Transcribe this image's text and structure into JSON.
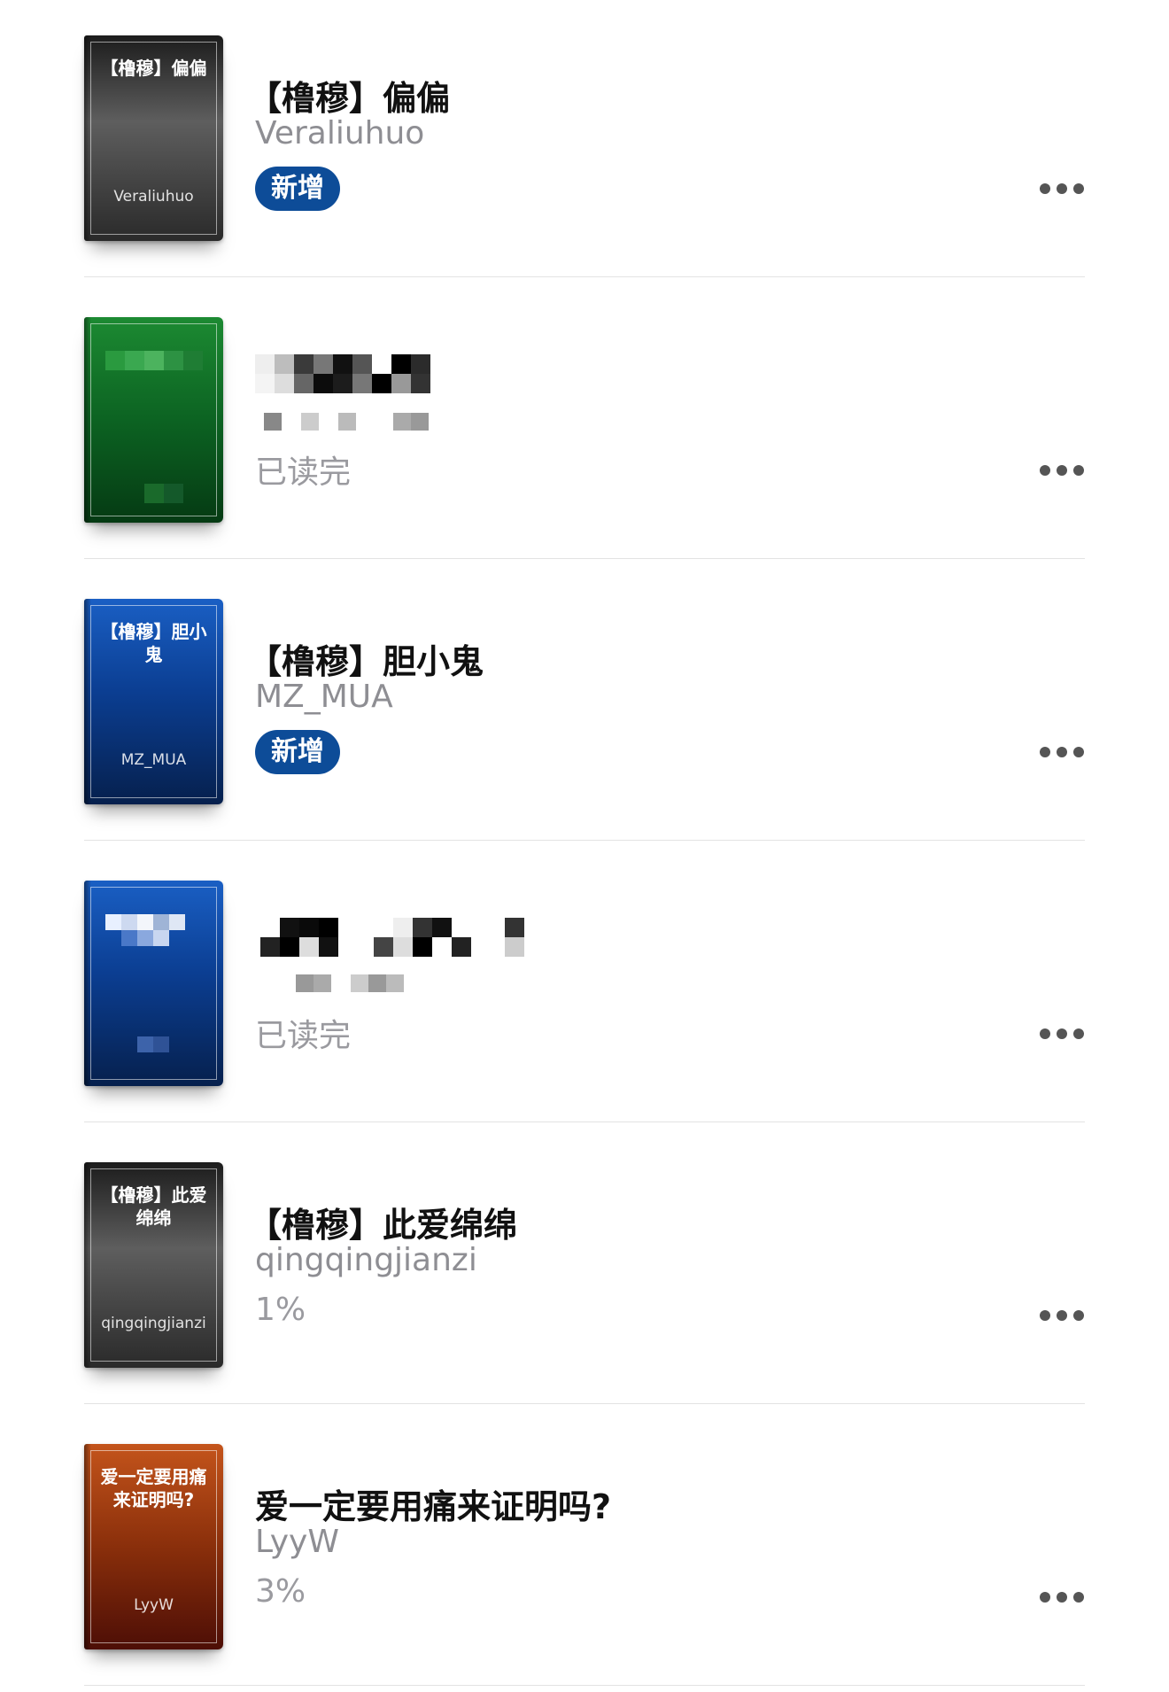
{
  "books": [
    {
      "cover_title": "【橹穆】偏偏",
      "cover_author": "Veraliuhuo",
      "title": "【橹穆】偏偏",
      "author": "Veraliuhuo",
      "status": "",
      "badge": "新增",
      "more_label": "•••",
      "blurred": false
    },
    {
      "cover_title": "",
      "cover_author": "",
      "title": "",
      "author": "",
      "status": "已读完",
      "badge": "",
      "more_label": "•••",
      "blurred": true
    },
    {
      "cover_title": "【橹穆】胆小鬼",
      "cover_author": "MZ_MUA",
      "title": "【橹穆】胆小鬼",
      "author": "MZ_MUA",
      "status": "",
      "badge": "新增",
      "more_label": "•••",
      "blurred": false
    },
    {
      "cover_title": "",
      "cover_author": "",
      "title": "",
      "author": "",
      "status": "已读完",
      "badge": "",
      "more_label": "•••",
      "blurred": true
    },
    {
      "cover_title": "【橹穆】此爱绵绵",
      "cover_author": "qingqingjianzi",
      "title": "【橹穆】此爱绵绵",
      "author": "qingqingjianzi",
      "status": "1%",
      "badge": "",
      "more_label": "•••",
      "blurred": false
    },
    {
      "cover_title": "爱一定要用痛来证明吗?",
      "cover_author": "LyyW",
      "title": "爱一定要用痛来证明吗?",
      "author": "LyyW",
      "status": "3%",
      "badge": "",
      "more_label": "•••",
      "blurred": false
    }
  ],
  "colors": {
    "badge": "#0d4c98",
    "cover_gray": "#3a3a3a",
    "cover_green": "#0c6322",
    "cover_blue": "#0b3e92",
    "cover_brown": "#8a2f0b"
  },
  "icons": {
    "more": "ellipsis-icon"
  }
}
